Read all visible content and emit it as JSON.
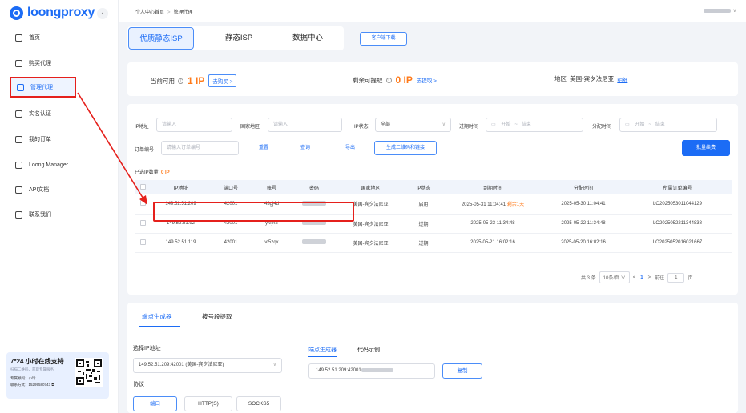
{
  "app": {
    "logo": "loongproxy",
    "collapse_glyph": "‹"
  },
  "sidebar": {
    "items": [
      {
        "label": "首页",
        "icon": "grid-icon"
      },
      {
        "label": "购买代理",
        "icon": "bag-icon"
      },
      {
        "label": "管理代理",
        "icon": "folder-icon",
        "active": true
      },
      {
        "label": "实名认证",
        "icon": "scan-icon"
      },
      {
        "label": "我的订单",
        "icon": "document-icon"
      },
      {
        "label": "Loong Manager",
        "icon": "window-icon"
      },
      {
        "label": "API文档",
        "icon": "code-icon"
      },
      {
        "label": "联系我们",
        "icon": "contact-icon"
      }
    ],
    "support": {
      "title": "7*24 小时在线支持",
      "subtitle": "扫描二维码，获取专属服务",
      "consultant": "专属顾问：小玲",
      "phone": "联系方式：15299580743"
    }
  },
  "breadcrumb": [
    "个人中心首页",
    "管理代理"
  ],
  "tabs": [
    "优质静态ISP",
    "静态ISP",
    "数据中心"
  ],
  "client_download": "客户端下载",
  "stats": {
    "available_label": "当前可用",
    "available_value": "1 IP",
    "buy_label": "去购买 >",
    "remaining_label": "剩余可提取",
    "remaining_value": "0 IP",
    "extract_label": "去提取 >",
    "region_label": "地区",
    "region_value": "美国-宾夕法尼亚",
    "detail_label": "明细"
  },
  "filters": {
    "ip_label": "IP地址",
    "ip_placeholder": "请输入",
    "country_label": "国家地区",
    "country_placeholder": "请输入",
    "status_label": "IP状态",
    "status_value": "全部",
    "expire_label": "过期时间",
    "assign_label": "分配时间",
    "start_placeholder": "开始",
    "range_sep": "~",
    "end_placeholder": "结束",
    "order_label": "订单编号",
    "order_placeholder": "请输入订单编号",
    "reset": "重置",
    "query": "查询",
    "export": "导出",
    "qrcode": "生成二维码和链接",
    "batch_renew": "批量续费"
  },
  "selected": {
    "label": "已选IP数量:",
    "count": "0 IP"
  },
  "table": {
    "headers": [
      "IP地址",
      "端口号",
      "账号",
      "密码",
      "国家地区",
      "IP状态",
      "到期时间",
      "分配时间",
      "所属订单编号"
    ],
    "rows": [
      {
        "ip": "149.52.51.209",
        "port": "42001",
        "account": "43gj4d",
        "region": "美国-宾夕法尼亚",
        "status": "启用",
        "expire": "2025-05-31 11:04:41",
        "remain": "剩余1天",
        "assigned": "2025-05-30 11:04:41",
        "order": "LO2025053011044129"
      },
      {
        "ip": "149.52.51.92",
        "port": "42001",
        "account": "ykfjh2",
        "region": "美国-宾夕法尼亚",
        "status": "过期",
        "expire": "2025-05-23 11:34:48",
        "remain": "",
        "assigned": "2025-05-22 11:34:48",
        "order": "LO2025052211344838"
      },
      {
        "ip": "149.52.51.119",
        "port": "42001",
        "account": "vf5zqx",
        "region": "美国-宾夕法尼亚",
        "status": "过期",
        "expire": "2025-05-21 16:02:16",
        "remain": "",
        "assigned": "2025-05-20 16:02:16",
        "order": "LO2025052016021667"
      }
    ]
  },
  "pagination": {
    "total": "共 3 条",
    "page_size": "10条/页",
    "prev": "<",
    "current": "1",
    "next": ">",
    "goto_label": "前往",
    "goto_value": "1",
    "page_suffix": "页"
  },
  "generator": {
    "tabs": [
      "端点生成器",
      "按号段提取"
    ],
    "select_ip_label": "选择IP地址",
    "select_ip_value": "149.52.51.209:42001 (美国-宾夕法尼亚)",
    "protocol_label": "协议",
    "protocols": [
      "端口",
      "HTTP(S)",
      "SOCKS5"
    ],
    "sub_tabs": [
      "端点生成器",
      "代码示例"
    ],
    "endpoint_value": "149.52.51.209:42001",
    "copy": "复制"
  },
  "colors": {
    "accent": "#1c6cf5",
    "highlight": "#e5201c",
    "warning": "#ff7a1a"
  }
}
